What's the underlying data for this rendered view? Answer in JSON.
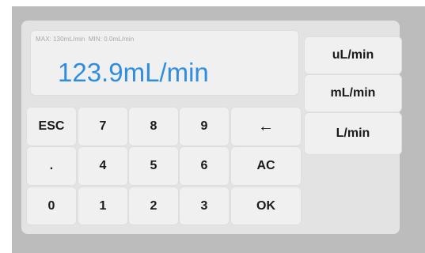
{
  "display": {
    "max_label": "MAX:",
    "max_value": "130mL/min",
    "min_label": "MIN:",
    "min_value": "0.0mL/min",
    "value": "123.9mL/min",
    "value_color": "#2f8de0"
  },
  "units": [
    "uL/min",
    "mL/min",
    "L/min"
  ],
  "keypad": {
    "row1": [
      "ESC",
      "7",
      "8",
      "9",
      "←"
    ],
    "row2": [
      ".",
      "4",
      "5",
      "6",
      "AC"
    ],
    "row3": [
      "0",
      "1",
      "2",
      "3",
      "OK"
    ]
  }
}
